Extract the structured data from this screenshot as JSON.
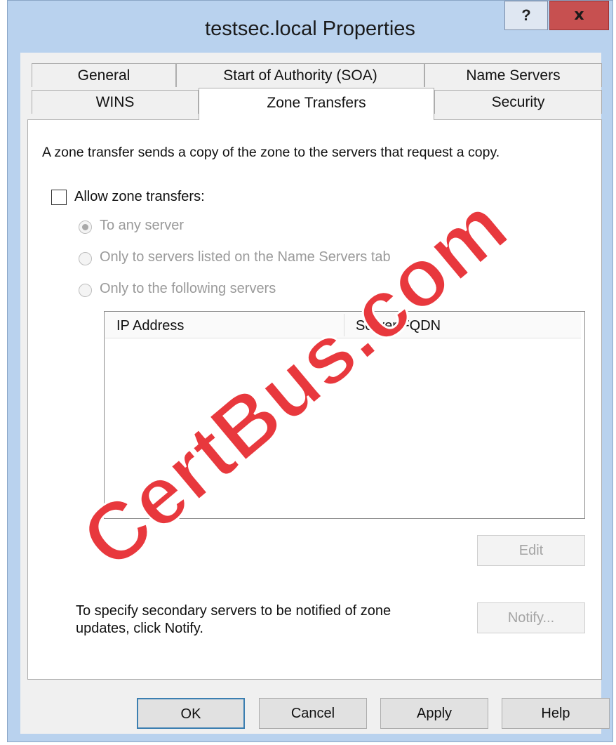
{
  "window": {
    "title": "testsec.local Properties",
    "help_label": "?",
    "close_label": "x"
  },
  "tabs": {
    "row1": [
      "General",
      "Start of Authority (SOA)",
      "Name Servers"
    ],
    "row2": [
      "WINS",
      "Zone Transfers",
      "Security"
    ],
    "active": "Zone Transfers"
  },
  "zone_transfers": {
    "description": "A zone transfer sends a copy of the zone to the servers that request a copy.",
    "allow_label": "Allow zone transfers:",
    "allow_checked": false,
    "options": [
      {
        "label": "To any server",
        "selected": true,
        "enabled": false
      },
      {
        "label": "Only to servers listed on the Name Servers tab",
        "selected": false,
        "enabled": false
      },
      {
        "label": "Only to the following servers",
        "selected": false,
        "enabled": false
      }
    ],
    "columns": [
      "IP Address",
      "Server FQDN"
    ],
    "rows": [],
    "edit_label": "Edit",
    "notify_text_line1": "To specify secondary servers to be notified of zone",
    "notify_text_line2": "updates, click Notify.",
    "notify_label": "Notify..."
  },
  "footer": {
    "ok": "OK",
    "cancel": "Cancel",
    "apply": "Apply",
    "help": "Help"
  },
  "watermark": "CertBus.com",
  "colors": {
    "title_bar": "#b9d2ee",
    "close_button": "#c75050",
    "watermark": "#e8383d"
  }
}
